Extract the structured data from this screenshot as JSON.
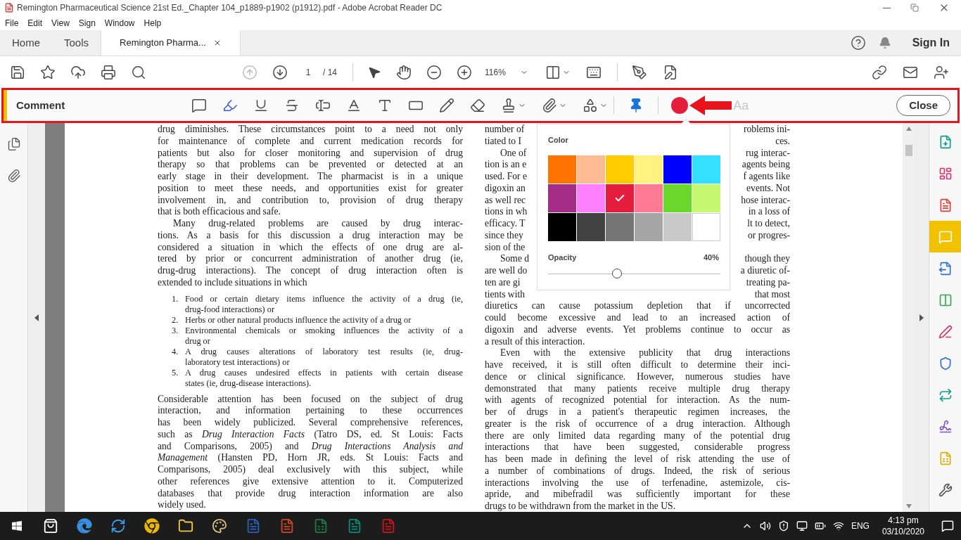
{
  "window": {
    "title": "Remington Pharmaceutical Science 21st Ed._Chapter 104_p1889-p1902 (p1912).pdf - Adobe Acrobat Reader DC"
  },
  "menu": [
    "File",
    "Edit",
    "View",
    "Sign",
    "Window",
    "Help"
  ],
  "tabs": [
    {
      "label": "Home",
      "selected": false
    },
    {
      "label": "Tools",
      "selected": false
    },
    {
      "label": "Remington Pharma...",
      "selected": true
    }
  ],
  "sign_in": "Sign In",
  "toolbar": {
    "page": "1",
    "page_total": "/ 14",
    "zoom": "116%"
  },
  "comment_bar": {
    "title": "Comment",
    "hint": "Aa",
    "close": "Close"
  },
  "color_popover": {
    "title": "Color",
    "opacity_label": "Opacity",
    "opacity_value": "40%",
    "level": 0.4,
    "swatches": [
      {
        "color": "#ff7300",
        "selected": false
      },
      {
        "color": "#ffbc94",
        "selected": false
      },
      {
        "color": "#ffcc00",
        "selected": false
      },
      {
        "color": "#fff281",
        "selected": false
      },
      {
        "color": "#0000ff",
        "selected": false
      },
      {
        "color": "#33e0ff",
        "selected": false
      },
      {
        "color": "#a42b86",
        "selected": false
      },
      {
        "color": "#ff80ff",
        "selected": false
      },
      {
        "color": "#e41e3c",
        "selected": true
      },
      {
        "color": "#ff7b95",
        "selected": false
      },
      {
        "color": "#6ad72a",
        "selected": false
      },
      {
        "color": "#c5f76f",
        "selected": false
      },
      {
        "color": "#000000",
        "selected": false
      },
      {
        "color": "#424242",
        "selected": false
      },
      {
        "color": "#757575",
        "selected": false
      },
      {
        "color": "#a6a6a6",
        "selected": false
      },
      {
        "color": "#c9c9c9",
        "selected": false
      },
      {
        "color": "#ffffff",
        "selected": false
      }
    ]
  },
  "document": {
    "left": [
      {
        "kind": "paragraph",
        "indent": false,
        "lines": [
          "drug diminishes. These circumstances point to a need not only",
          "for maintenance of complete and current medication records for",
          "patients but also for closer monitoring and supervision of drug",
          "therapy so that problems can be prevented or detected at an",
          "early stage in their development. The pharmacist is in a unique",
          "position to meet these needs, and opportunities exist for greater",
          "involvement in, and contribution to, provision of drug therapy",
          "that is both efficacious and safe."
        ]
      },
      {
        "kind": "paragraph",
        "indent": true,
        "lines": [
          "Many drug-related problems are caused by drug interac-",
          "tions. As a basis for this discussion a drug interaction may be",
          "considered a situation in which the effects of one drug are al-",
          "tered by prior or concurrent administration of another drug (ie,",
          "drug-drug interactions). The concept of drug interaction often is",
          "extended to include situations in which"
        ]
      },
      {
        "kind": "list",
        "items": [
          {
            "number": "1.",
            "lines": [
              "Food or certain dietary items influence the activity of a drug (ie,",
              "drug-food interactions) or"
            ]
          },
          {
            "number": "2.",
            "lines": [
              "Herbs or other natural products influence the activity of a drug or"
            ]
          },
          {
            "number": "3.",
            "lines": [
              "Environmental chemicals or smoking influences the activity of a",
              "drug or"
            ]
          },
          {
            "number": "4.",
            "lines": [
              "A drug causes alterations of laboratory test results (ie, drug-",
              "laboratory test interactions) or"
            ]
          },
          {
            "number": "5.",
            "lines": [
              "A drug causes undesired effects in patients with certain disease",
              "states (ie, drug-disease interactions)."
            ]
          }
        ]
      },
      {
        "kind": "paragraph",
        "indent": false,
        "lines": [
          "Considerable attention has been focused on the subject of drug",
          "interaction, and information pertaining to these occurrences",
          "has been widely publicized. Several comprehensive references,",
          "such as *Drug Interaction Facts* (Tatro DS, ed. St Louis: Facts",
          "and Comparisons, 2005) and *Drug Interactions Analysis and*",
          "*Management* (Hansten PD, Horn JR, eds. St Louis: Facts and",
          "Comparisons, 2005) deal exclusively with this subject, while",
          "other references give extensive attention to it. Computerized",
          "databases that provide drug interaction information are also",
          "widely used."
        ]
      }
    ],
    "right": [
      {
        "kind": "paragraph",
        "indent": false,
        "lines": [
          {
            "left": "number of",
            "right": "roblems ini-"
          },
          {
            "left": "tiated to I",
            "right": "ces."
          }
        ]
      },
      {
        "kind": "paragraph",
        "indent": true,
        "lines": [
          {
            "left": "One of",
            "right": "rug interac-"
          },
          {
            "left": "tion is an e",
            "right": "agents being"
          },
          {
            "left": "used. For e",
            "right": "f agents like"
          },
          {
            "left": "digoxin an",
            "right": "events. Not"
          },
          {
            "left": "as well rec",
            "right": "hose interac-"
          },
          {
            "left": "tions in wh",
            "right": "in a loss of"
          },
          {
            "left": "efficacy. T",
            "right": "lt to detect,"
          },
          {
            "left": "since they",
            "right": "or progres-"
          },
          {
            "left": "sion of the"
          }
        ]
      },
      {
        "kind": "paragraph",
        "indent": true,
        "lines": [
          {
            "left": "Some d",
            "right": "though they"
          },
          {
            "left": "are well do",
            "right": "a diuretic of-"
          },
          {
            "left": "ten are gi",
            "right": "treating pa-"
          },
          {
            "left": "tients with",
            "right": "that most"
          },
          "diuretics can cause potassium depletion that if uncorrected",
          "could become excessive and lead to an increased action of",
          "digoxin and adverse events. Yet problems continue to occur as",
          "a result of this interaction."
        ]
      },
      {
        "kind": "paragraph",
        "indent": true,
        "lines": [
          "Even with the extensive publicity that drug interactions",
          "have received, it is still often difficult to determine their inci-",
          "dence or clinical significance. However, numerous studies have",
          "demonstrated that many patients receive multiple drug therapy",
          "with agents of recognized potential for interaction. As the num-",
          "ber of drugs in a patient's therapeutic regimen increases, the",
          "greater is the risk of occurrence of a drug interaction. Although",
          "there are only limited data regarding many of the potential drug",
          "interactions that have been suggested, considerable progress",
          "has been made in defining the level of risk attending the use of",
          "a number of combinations of drugs. Indeed, the risk of serious",
          "interactions involving the use of terfenadine, astemizole, cis-",
          "apride, and mibefradil was sufficiently important for these",
          "drugs to be withdrawn from the market in the US."
        ]
      }
    ]
  },
  "right_tools": [
    {
      "selected": false
    },
    {
      "selected": false
    },
    {
      "selected": false
    },
    {
      "selected": true
    },
    {
      "selected": false
    },
    {
      "selected": false
    },
    {
      "selected": false
    },
    {
      "selected": false
    },
    {
      "selected": false
    },
    {
      "selected": false
    },
    {
      "selected": false
    },
    {
      "selected": false
    }
  ],
  "taskbar": {
    "language": "ENG",
    "time": "4:13 pm",
    "date": "03/10/2020"
  }
}
